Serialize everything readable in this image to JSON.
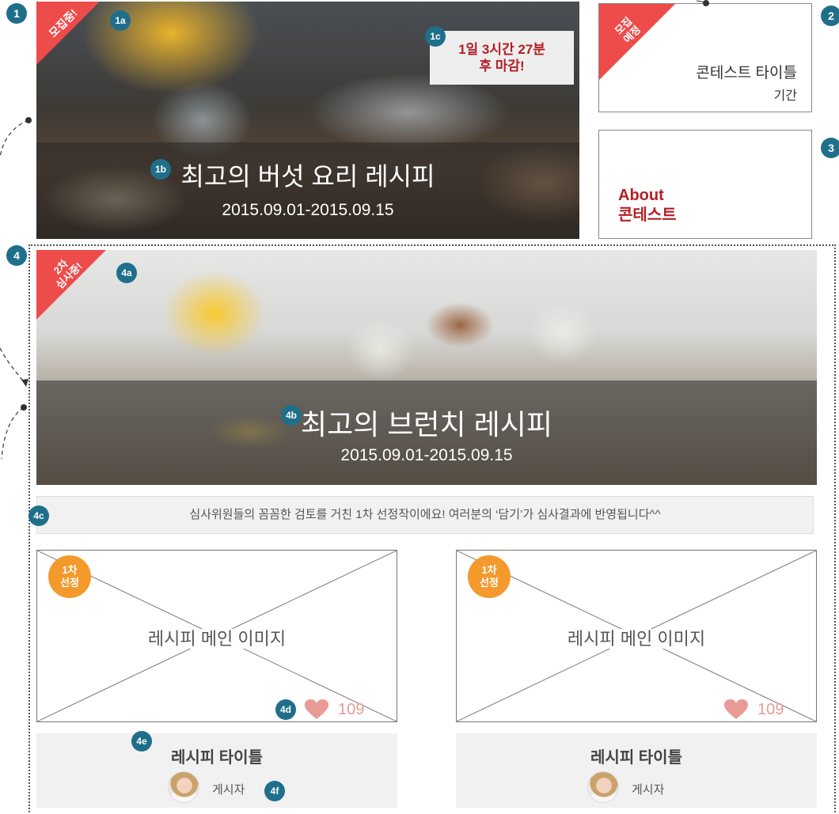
{
  "markers": {
    "m1": "1",
    "m1a": "1a",
    "m1b": "1b",
    "m1c": "1c",
    "m2": "2",
    "m3": "3",
    "m4": "4",
    "m4a": "4a",
    "m4b": "4b",
    "m4c": "4c",
    "m4d": "4d",
    "m4e": "4e",
    "m4f": "4f"
  },
  "contest1": {
    "status_ribbon": "모집중!",
    "countdown_line1": "1일 3시간 27분",
    "countdown_line2": "후 마감!",
    "title": "최고의 버섯 요리 레시피",
    "period": "2015.09.01-2015.09.15"
  },
  "contest2": {
    "status_ribbon_line1": "모집",
    "status_ribbon_line2": "예정",
    "title": "콘테스트 타이틀",
    "period_label": "기간"
  },
  "about": {
    "line1": "About",
    "line2": "콘테스트"
  },
  "contest4": {
    "status_ribbon_line1": "2차",
    "status_ribbon_line2": "심사중!",
    "title": "최고의 브런치 레시피",
    "period": "2015.09.01-2015.09.15",
    "notice": "심사위원들의 꼼꼼한 검토를 거친 1차 선정작이에요! 여러분의 ‘담기’가 심사결과에 반영됩니다^^"
  },
  "recipes": [
    {
      "badge_line1": "1차",
      "badge_line2": "선정",
      "image_placeholder": "레시피 메인 이미지",
      "likes": "109",
      "title": "레시피 타이틀",
      "author": "게시자"
    },
    {
      "badge_line1": "1차",
      "badge_line2": "선정",
      "image_placeholder": "레시피 메인 이미지",
      "likes": "109",
      "title": "레시피 타이틀",
      "author": "게시자"
    }
  ],
  "colors": {
    "accent": "#1f6f8b",
    "ribbon": "#ee4b4b",
    "badge": "#f49a2c",
    "heart": "#e89b95",
    "about": "#b21f24"
  }
}
